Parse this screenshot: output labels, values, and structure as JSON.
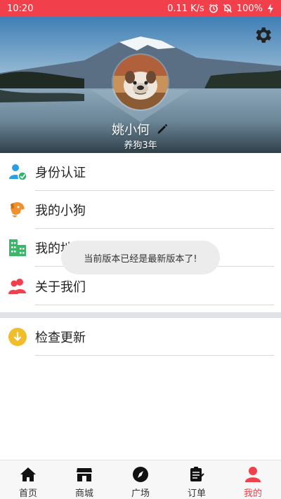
{
  "status_bar": {
    "time": "10:20",
    "network_speed": "0.11 K/s",
    "battery": "100%",
    "icons": [
      "alarm-icon",
      "mute-icon",
      "charging-icon"
    ]
  },
  "profile": {
    "name": "姚小何",
    "subtitle": "养狗3年",
    "icons": [
      "settings-icon",
      "edit-icon"
    ]
  },
  "menu": {
    "items": [
      {
        "label": "身份认证",
        "icon": "verified-user-icon",
        "color": "#2aa0e0"
      },
      {
        "label": "我的小狗",
        "icon": "dog-icon",
        "color": "#f0912d"
      },
      {
        "label": "我的地址",
        "icon": "building-icon",
        "color": "#3db56a"
      },
      {
        "label": "关于我们",
        "icon": "people-icon",
        "color": "#f1404b"
      }
    ],
    "update": {
      "label": "检查更新",
      "icon": "download-icon",
      "color": "#f2bd2a"
    }
  },
  "toast": {
    "message": "当前版本已经是最新版本了!"
  },
  "tabs": [
    {
      "label": "首页",
      "icon": "home-icon",
      "active": false
    },
    {
      "label": "商城",
      "icon": "shop-icon",
      "active": false
    },
    {
      "label": "广场",
      "icon": "compass-icon",
      "active": false
    },
    {
      "label": "订单",
      "icon": "order-icon",
      "active": false
    },
    {
      "label": "我的",
      "icon": "user-icon",
      "active": true
    }
  ],
  "colors": {
    "accent": "#f1404b",
    "divider": "#d9d9d9"
  }
}
